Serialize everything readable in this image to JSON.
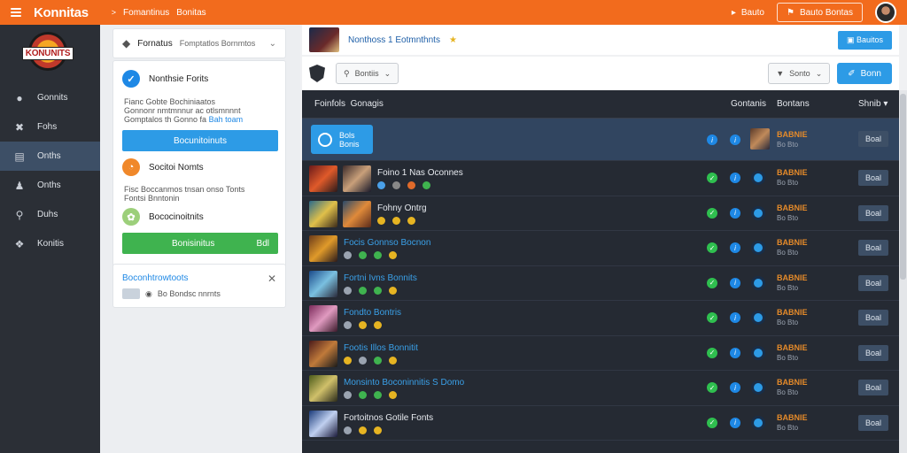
{
  "topbar": {
    "brand": "Konnitas",
    "crumb_arrow": ">",
    "crumb1": "Fomantinus",
    "crumb2": "Bonitas",
    "link": "Bauto",
    "button": "Bauto Bontas",
    "bg_color": "#f26b1d"
  },
  "sidebar": {
    "logo_text": "KONUNITS",
    "items": [
      {
        "label": "Gonnits",
        "icon": "gamepad-icon"
      },
      {
        "label": "Fohs",
        "icon": "tools-icon"
      },
      {
        "label": "Onths",
        "icon": "list-icon"
      },
      {
        "label": "Onths",
        "icon": "user-icon"
      },
      {
        "label": "Duhs",
        "icon": "search-icon"
      },
      {
        "label": "Konitis",
        "icon": "trophy-icon"
      }
    ]
  },
  "mid": {
    "search_label": "Fornatus",
    "search_sub": "Fomptatlos Bornmtos",
    "card1_title": "Nonthsie Forits",
    "card1_text1": "Fianc Gobte Bochiniaatos",
    "card1_text2": "Gonnonr nmtmnnur ac otlsmnnnt",
    "card1_text3": "Gomptalos th Gonno fa",
    "card1_link": "Bah toam",
    "blue_button": "Bocunitoinuts",
    "card2_title": "Socitoi Nomts",
    "card2_text": "Fisc Boccanmos tnsan onso Tonts",
    "card2_text2": "Fontsi Bnntonin",
    "card3_title": "Bococinoitnits",
    "green_button": "Bonisinitus",
    "green_count": "Bdl",
    "note_title": "Boconhtrowtoots",
    "note_text": "Bo Bondsc nnrnts"
  },
  "content": {
    "header_title": "Nonthoss 1 Eotmnthnts",
    "header_button": "Bauitos",
    "select1": "Bontiis",
    "select2": "Sonto",
    "blue_btn": "Bonn",
    "table": {
      "col_name_a": "Foinfols",
      "col_name_b": "Gonagis",
      "col_c1": "Gontanis",
      "col_c2": "Bontans",
      "col_c3": "Shnib",
      "featured": {
        "btn_line1": "Bols",
        "btn_line2": "Bonis",
        "status": "BABNIE",
        "status_sub": "Bo Bto",
        "action": "Boal"
      },
      "rows": [
        {
          "title": "Foino 1 Nas Oconnes",
          "style": "white",
          "status": "BABNIE",
          "status_sub": "Bo Bto",
          "action": "Boal"
        },
        {
          "title": "Fohny Ontrg",
          "style": "white",
          "status": "BABNIE",
          "status_sub": "Bo Bto",
          "action": "Boal"
        },
        {
          "title": "Focis Gonnso Bocnon",
          "style": "blue",
          "status": "BABNIE",
          "status_sub": "Bo Bto",
          "action": "Boal"
        },
        {
          "title": "Fortni Ivns Bonnits",
          "style": "blue",
          "status": "BABNIE",
          "status_sub": "Bo Bto",
          "action": "Boal"
        },
        {
          "title": "Fondto Bontris",
          "style": "blue",
          "status": "BABNIE",
          "status_sub": "Bo Bto",
          "action": "Boal"
        },
        {
          "title": "Footis Illos Bonnitit",
          "style": "blue",
          "status": "BABNIE",
          "status_sub": "Bo Bto",
          "action": "Boal"
        },
        {
          "title": "Monsinto Boconinnitis S Domo",
          "style": "blue",
          "status": "BABNIE",
          "status_sub": "Bo Bto",
          "action": "Boal"
        },
        {
          "title": "Fortoitnos Gotile Fonts",
          "style": "white",
          "status": "BABNIE",
          "status_sub": "Bo Bto",
          "action": "Boal"
        }
      ]
    }
  }
}
